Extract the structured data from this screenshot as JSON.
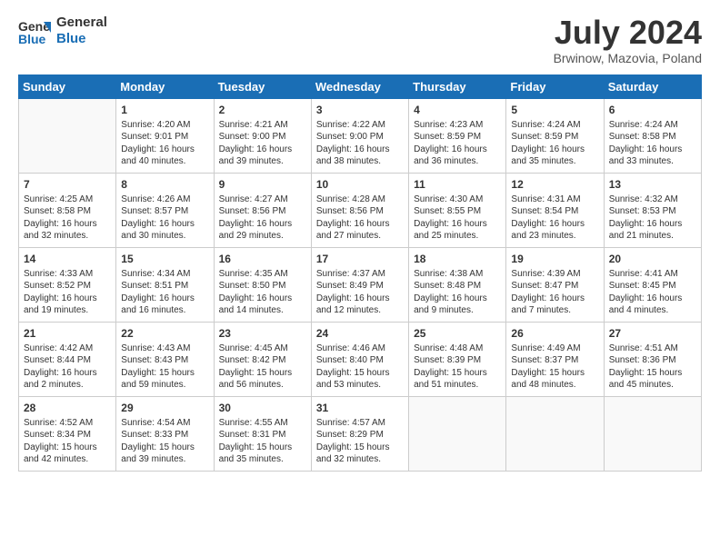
{
  "header": {
    "logo_line1": "General",
    "logo_line2": "Blue",
    "month": "July 2024",
    "location": "Brwinow, Mazovia, Poland"
  },
  "weekdays": [
    "Sunday",
    "Monday",
    "Tuesday",
    "Wednesday",
    "Thursday",
    "Friday",
    "Saturday"
  ],
  "weeks": [
    [
      {
        "day": "",
        "info": ""
      },
      {
        "day": "1",
        "info": "Sunrise: 4:20 AM\nSunset: 9:01 PM\nDaylight: 16 hours\nand 40 minutes."
      },
      {
        "day": "2",
        "info": "Sunrise: 4:21 AM\nSunset: 9:00 PM\nDaylight: 16 hours\nand 39 minutes."
      },
      {
        "day": "3",
        "info": "Sunrise: 4:22 AM\nSunset: 9:00 PM\nDaylight: 16 hours\nand 38 minutes."
      },
      {
        "day": "4",
        "info": "Sunrise: 4:23 AM\nSunset: 8:59 PM\nDaylight: 16 hours\nand 36 minutes."
      },
      {
        "day": "5",
        "info": "Sunrise: 4:24 AM\nSunset: 8:59 PM\nDaylight: 16 hours\nand 35 minutes."
      },
      {
        "day": "6",
        "info": "Sunrise: 4:24 AM\nSunset: 8:58 PM\nDaylight: 16 hours\nand 33 minutes."
      }
    ],
    [
      {
        "day": "7",
        "info": "Sunrise: 4:25 AM\nSunset: 8:58 PM\nDaylight: 16 hours\nand 32 minutes."
      },
      {
        "day": "8",
        "info": "Sunrise: 4:26 AM\nSunset: 8:57 PM\nDaylight: 16 hours\nand 30 minutes."
      },
      {
        "day": "9",
        "info": "Sunrise: 4:27 AM\nSunset: 8:56 PM\nDaylight: 16 hours\nand 29 minutes."
      },
      {
        "day": "10",
        "info": "Sunrise: 4:28 AM\nSunset: 8:56 PM\nDaylight: 16 hours\nand 27 minutes."
      },
      {
        "day": "11",
        "info": "Sunrise: 4:30 AM\nSunset: 8:55 PM\nDaylight: 16 hours\nand 25 minutes."
      },
      {
        "day": "12",
        "info": "Sunrise: 4:31 AM\nSunset: 8:54 PM\nDaylight: 16 hours\nand 23 minutes."
      },
      {
        "day": "13",
        "info": "Sunrise: 4:32 AM\nSunset: 8:53 PM\nDaylight: 16 hours\nand 21 minutes."
      }
    ],
    [
      {
        "day": "14",
        "info": "Sunrise: 4:33 AM\nSunset: 8:52 PM\nDaylight: 16 hours\nand 19 minutes."
      },
      {
        "day": "15",
        "info": "Sunrise: 4:34 AM\nSunset: 8:51 PM\nDaylight: 16 hours\nand 16 minutes."
      },
      {
        "day": "16",
        "info": "Sunrise: 4:35 AM\nSunset: 8:50 PM\nDaylight: 16 hours\nand 14 minutes."
      },
      {
        "day": "17",
        "info": "Sunrise: 4:37 AM\nSunset: 8:49 PM\nDaylight: 16 hours\nand 12 minutes."
      },
      {
        "day": "18",
        "info": "Sunrise: 4:38 AM\nSunset: 8:48 PM\nDaylight: 16 hours\nand 9 minutes."
      },
      {
        "day": "19",
        "info": "Sunrise: 4:39 AM\nSunset: 8:47 PM\nDaylight: 16 hours\nand 7 minutes."
      },
      {
        "day": "20",
        "info": "Sunrise: 4:41 AM\nSunset: 8:45 PM\nDaylight: 16 hours\nand 4 minutes."
      }
    ],
    [
      {
        "day": "21",
        "info": "Sunrise: 4:42 AM\nSunset: 8:44 PM\nDaylight: 16 hours\nand 2 minutes."
      },
      {
        "day": "22",
        "info": "Sunrise: 4:43 AM\nSunset: 8:43 PM\nDaylight: 15 hours\nand 59 minutes."
      },
      {
        "day": "23",
        "info": "Sunrise: 4:45 AM\nSunset: 8:42 PM\nDaylight: 15 hours\nand 56 minutes."
      },
      {
        "day": "24",
        "info": "Sunrise: 4:46 AM\nSunset: 8:40 PM\nDaylight: 15 hours\nand 53 minutes."
      },
      {
        "day": "25",
        "info": "Sunrise: 4:48 AM\nSunset: 8:39 PM\nDaylight: 15 hours\nand 51 minutes."
      },
      {
        "day": "26",
        "info": "Sunrise: 4:49 AM\nSunset: 8:37 PM\nDaylight: 15 hours\nand 48 minutes."
      },
      {
        "day": "27",
        "info": "Sunrise: 4:51 AM\nSunset: 8:36 PM\nDaylight: 15 hours\nand 45 minutes."
      }
    ],
    [
      {
        "day": "28",
        "info": "Sunrise: 4:52 AM\nSunset: 8:34 PM\nDaylight: 15 hours\nand 42 minutes."
      },
      {
        "day": "29",
        "info": "Sunrise: 4:54 AM\nSunset: 8:33 PM\nDaylight: 15 hours\nand 39 minutes."
      },
      {
        "day": "30",
        "info": "Sunrise: 4:55 AM\nSunset: 8:31 PM\nDaylight: 15 hours\nand 35 minutes."
      },
      {
        "day": "31",
        "info": "Sunrise: 4:57 AM\nSunset: 8:29 PM\nDaylight: 15 hours\nand 32 minutes."
      },
      {
        "day": "",
        "info": ""
      },
      {
        "day": "",
        "info": ""
      },
      {
        "day": "",
        "info": ""
      }
    ]
  ]
}
